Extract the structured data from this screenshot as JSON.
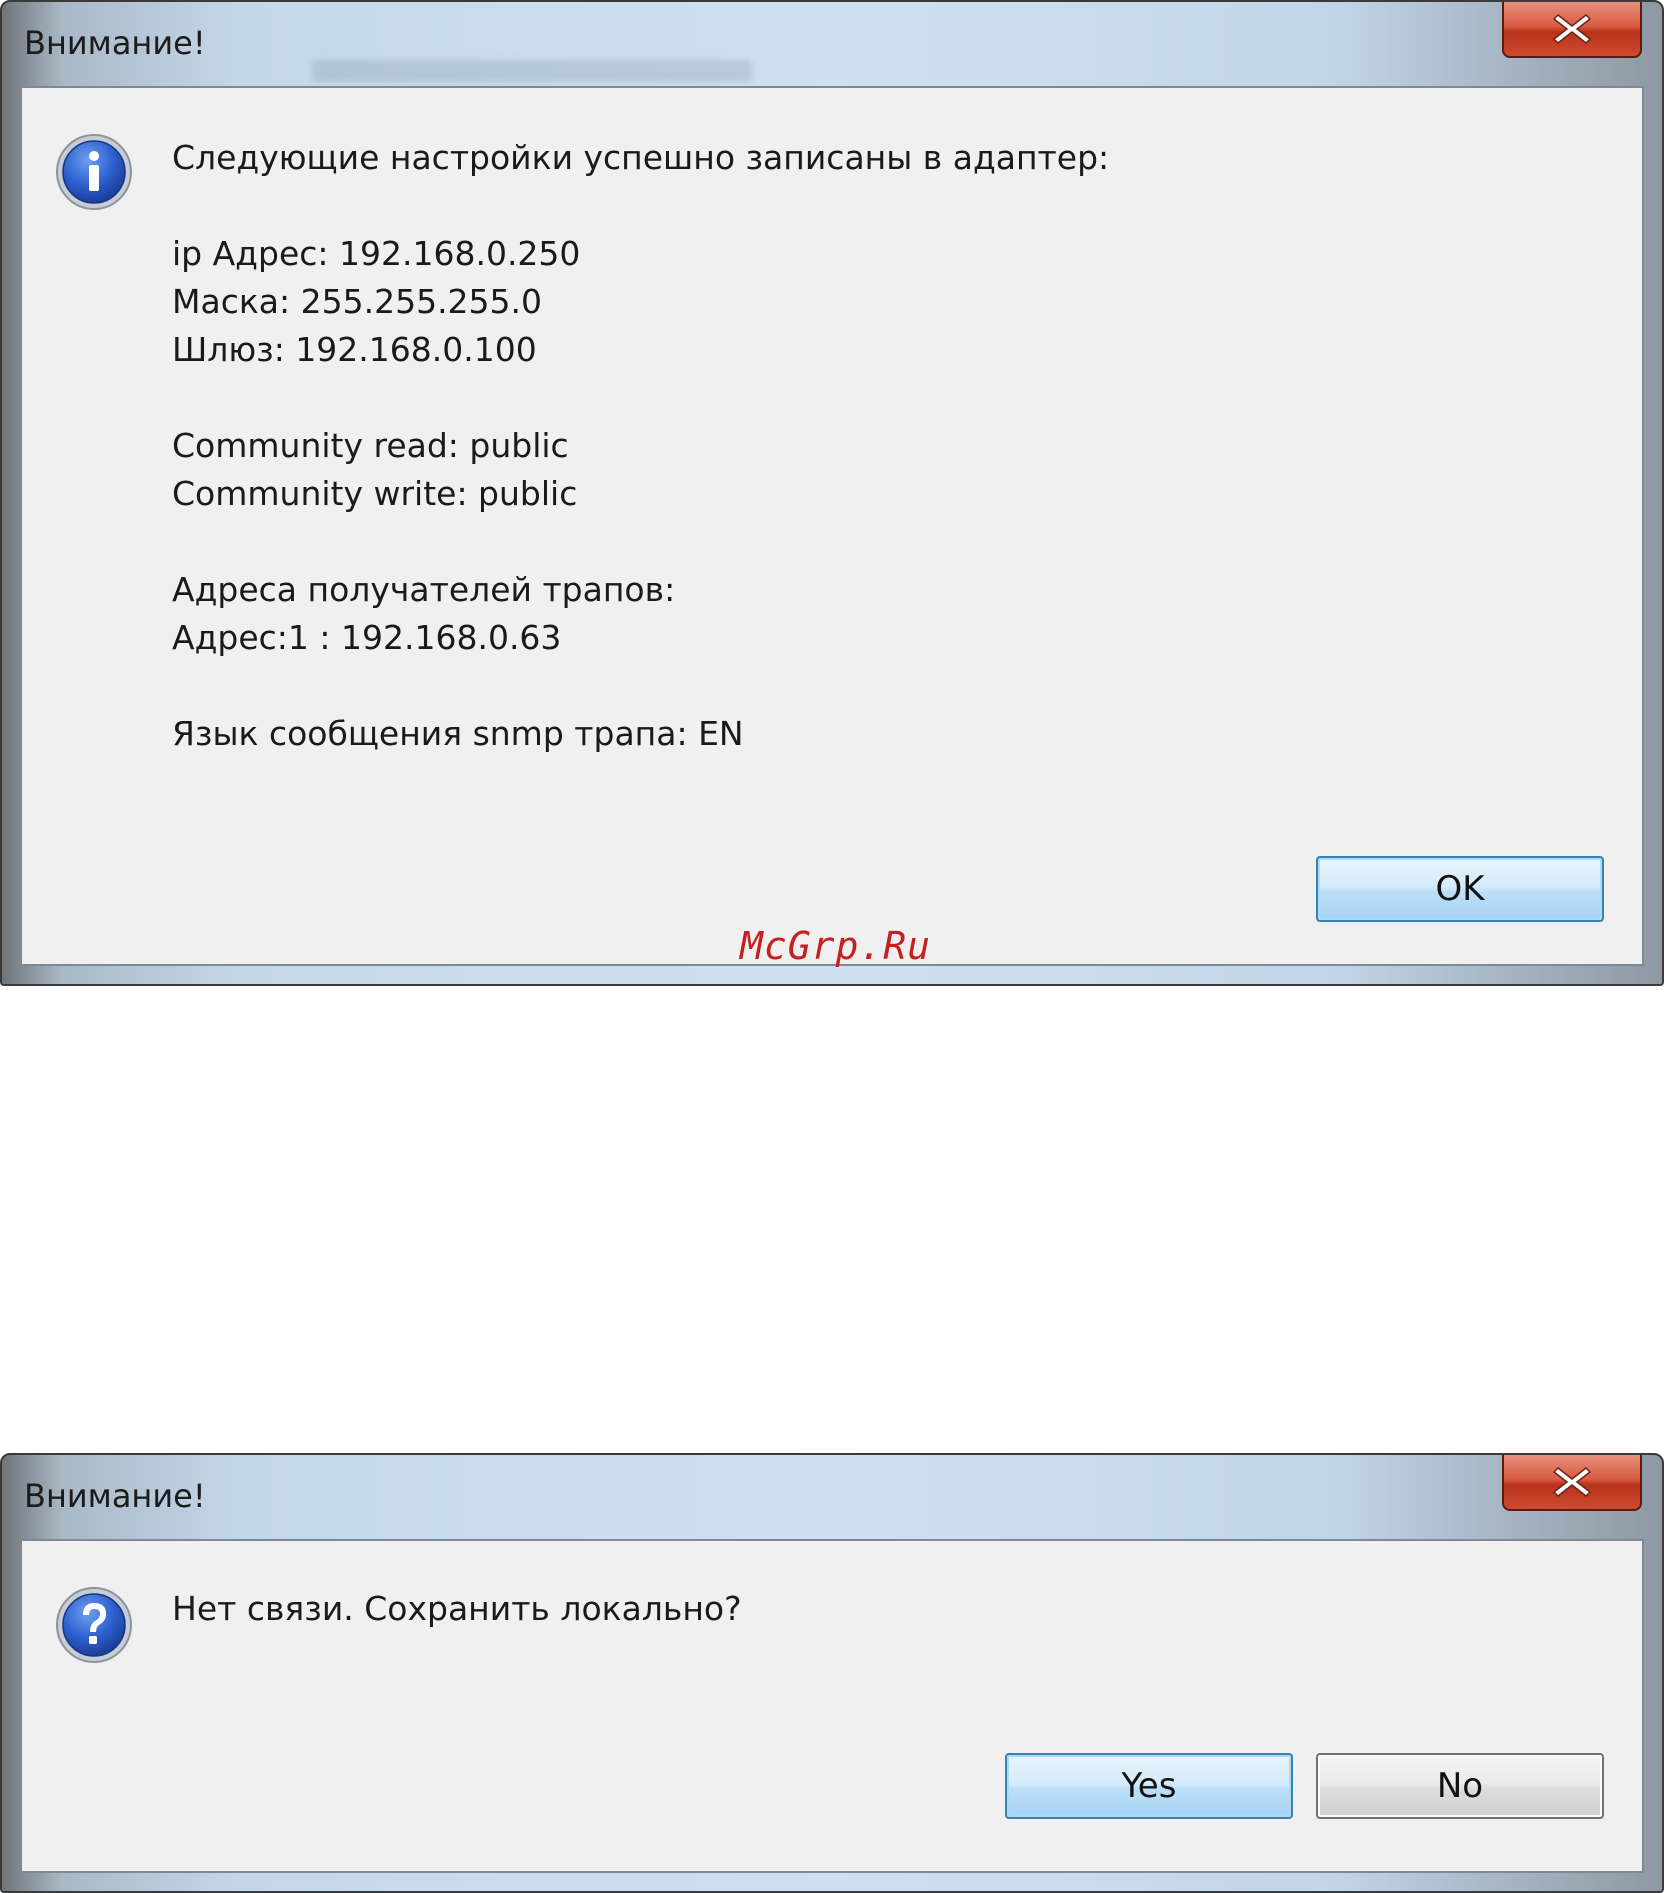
{
  "dialog1": {
    "title": "Внимание!",
    "icon": "info-icon",
    "message_lines": {
      "heading": "Следующие настройки успешно записаны в адаптер:",
      "ip": "ip Адрес: 192.168.0.250",
      "mask": "Маска: 255.255.255.0",
      "gateway": "Шлюз: 192.168.0.100",
      "community_read": "Community read: public",
      "community_write": "Community write: public",
      "trap_heading": "Адреса получателей трапов:",
      "trap_address_1": "Адрес:1 : 192.168.0.63",
      "trap_language": "Язык сообщения snmp трапа: EN"
    },
    "ok_label": "OK"
  },
  "dialog2": {
    "title": "Внимание!",
    "icon": "question-icon",
    "message": "Нет связи. Сохранить локально?",
    "yes_label": "Yes",
    "no_label": "No"
  },
  "watermark": "McGrp.Ru",
  "colors": {
    "close_button": "#c8452c",
    "primary_button_border": "#3c7fb1",
    "client_background": "#f0f0f0",
    "watermark": "#c61f1f"
  }
}
